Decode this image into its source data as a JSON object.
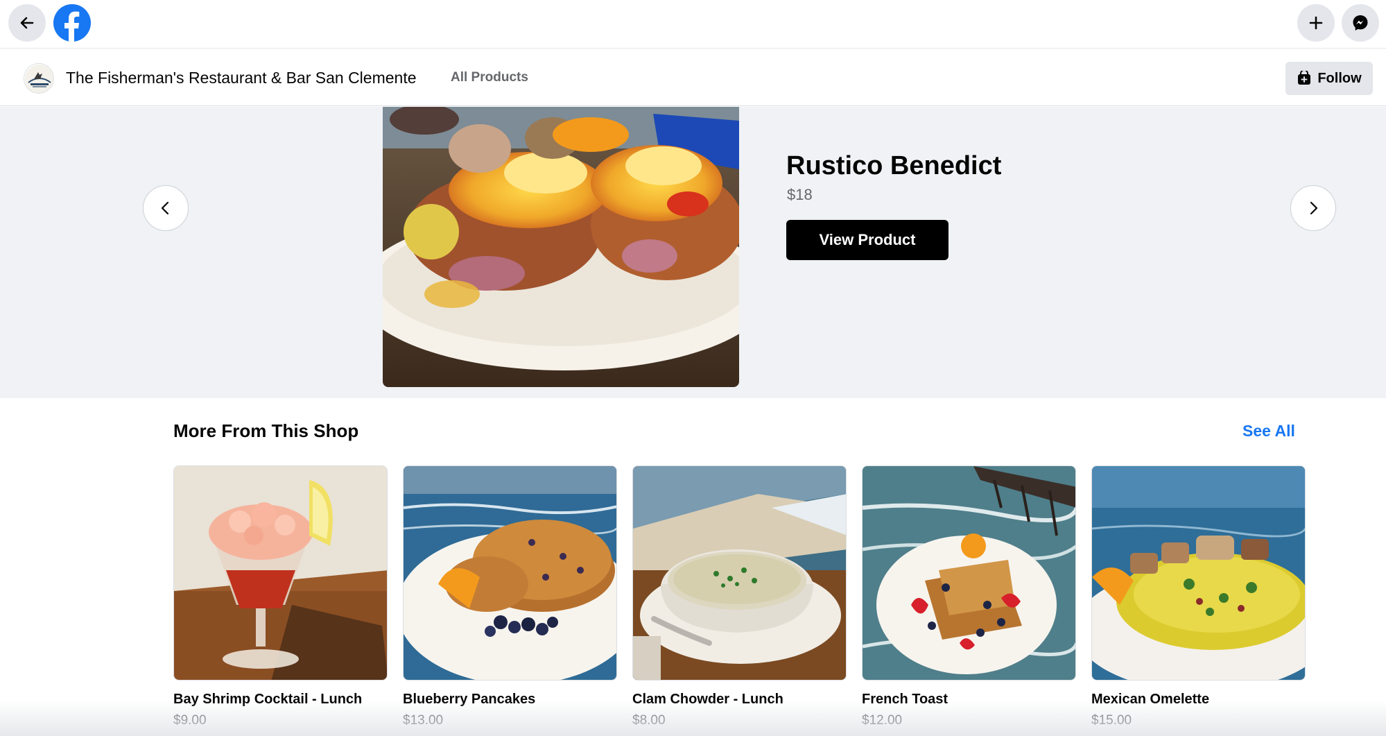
{
  "topbar": {
    "icons": [
      "back-arrow-icon",
      "facebook-logo",
      "plus-icon",
      "messenger-icon"
    ]
  },
  "shop": {
    "name": "The Fisherman's Restaurant & Bar San Clemente",
    "nav_all_products": "All Products",
    "follow_label": "Follow"
  },
  "hero": {
    "title": "Rustico Benedict",
    "price": "$18",
    "button_label": "View Product"
  },
  "more": {
    "title": "More From This Shop",
    "see_all": "See All",
    "products": [
      {
        "name": "Bay Shrimp Cocktail - Lunch",
        "price": "$9.00"
      },
      {
        "name": "Blueberry Pancakes",
        "price": "$13.00"
      },
      {
        "name": "Clam Chowder - Lunch",
        "price": "$8.00"
      },
      {
        "name": "French Toast",
        "price": "$12.00"
      },
      {
        "name": "Mexican Omelette",
        "price": "$15.00"
      }
    ]
  },
  "colors": {
    "facebook_blue": "#1877f2",
    "hero_background": "#f0f2f5",
    "button_black": "#000000",
    "secondary_text": "#65676b"
  }
}
